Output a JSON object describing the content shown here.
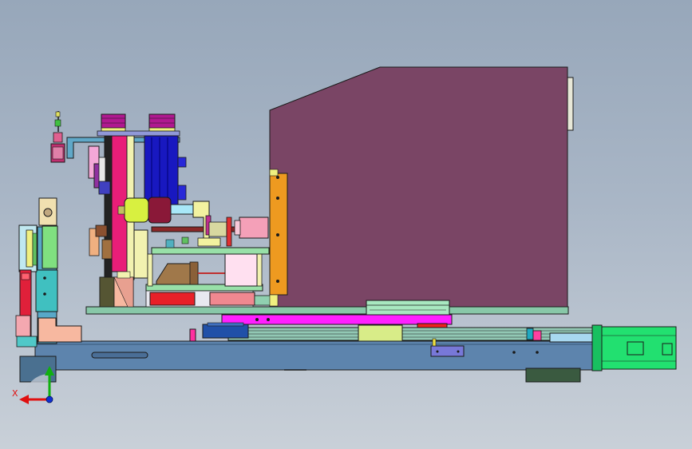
{
  "triad": {
    "x_label": "X",
    "y_label": "",
    "x_color": "#e01010",
    "y_color": "#10b010",
    "z_color": "#1030d0"
  },
  "colors": {
    "background_top": "#97a7ba",
    "background_bottom": "#c9d0d8",
    "enclosure": "#7a4565",
    "base_rail": "#5d84ad",
    "servo_motor": "#22e070",
    "blue_motor": "#1818c0",
    "orange_plate": "#ee9a20",
    "magenta_slider": "#ff20ff",
    "red_cylinder": "#e0203a",
    "yellow_parts": "#f0f0a0",
    "lime_parts": "#d8f040",
    "pink_parts": "#f4a0b8",
    "green_plate": "#98e0a8",
    "outline": "#1a1a1a"
  }
}
